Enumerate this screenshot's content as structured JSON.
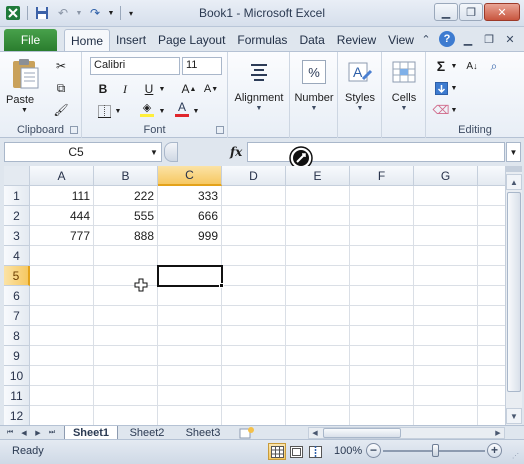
{
  "window": {
    "title": "Book1  -  Microsoft Excel"
  },
  "ribbon_tabs": {
    "file": "File",
    "tabs": [
      "Home",
      "Insert",
      "Page Layout",
      "Formulas",
      "Data",
      "Review",
      "View"
    ]
  },
  "ribbon": {
    "clipboard": {
      "label": "Clipboard",
      "paste": "Paste"
    },
    "font": {
      "label": "Font",
      "name": "Calibri",
      "size": "11",
      "bold": "B",
      "italic": "I",
      "underline": "U"
    },
    "alignment": {
      "label": "Alignment"
    },
    "number": {
      "label": "Number",
      "symbol": "%"
    },
    "styles": {
      "label": "Styles"
    },
    "cells": {
      "label": "Cells"
    },
    "editing": {
      "label": "Editing",
      "sum": "Σ"
    }
  },
  "formula_bar": {
    "name_box": "C5",
    "fx": "fx",
    "content": ""
  },
  "grid": {
    "columns": [
      "A",
      "B",
      "C",
      "D",
      "E",
      "F",
      "G"
    ],
    "rows": [
      "1",
      "2",
      "3",
      "4",
      "5",
      "6",
      "7",
      "8",
      "9",
      "10",
      "11",
      "12"
    ],
    "cells": [
      [
        "111",
        "222",
        "333"
      ],
      [
        "444",
        "555",
        "666"
      ],
      [
        "777",
        "888",
        "999"
      ]
    ],
    "active_cell": "C5"
  },
  "sheets": {
    "tabs": [
      "Sheet1",
      "Sheet2",
      "Sheet3"
    ],
    "active": "Sheet1"
  },
  "status": {
    "ready": "Ready",
    "zoom": "100%",
    "zoom_level": 1.0
  },
  "colors": {
    "file_tab": "#2a7d2e",
    "selected_header": "#f6c862",
    "font_color_bar": "#e0262c",
    "highlight_bar": "#ffef3a"
  }
}
